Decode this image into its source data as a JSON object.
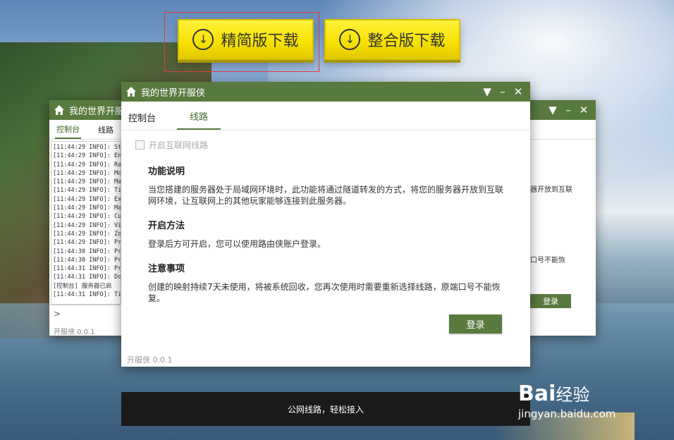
{
  "buttons": {
    "lite_label": "精简版下载",
    "full_label": "整合版下载",
    "download_icon": "↓"
  },
  "window": {
    "title": "我的世界开服侠",
    "minimize": "–",
    "menu": "▼",
    "close": "✕"
  },
  "back_window": {
    "tabs": [
      "控制台",
      "线路"
    ],
    "log": [
      "[11:44:29 INFO]: St",
      "[11:44:29 INFO]: Ent",
      "[11:44:29 INFO]: Ran",
      "[11:44:29 INFO]: Mob",
      "[11:44:29 INFO]: Max",
      "[11:44:29 INFO]: Til",
      "[11:44:29 INFO]: Exp",
      "[11:44:29 INFO]: Max",
      "[11:44:29 INFO]: Cus",
      "[11:44:29 INFO]: Vie",
      "[11:44:29 INFO]: Zom",
      "[11:44:29 INFO]: Pre",
      "[11:44:30 INFO]: Pre",
      "[11:44:30 INFO]: Pre",
      "[11:44:31 INFO]: Pre",
      "[11:44:31 INFO]: Don",
      "[控制台] 服务器已启",
      "[11:44:31 INFO]: Tim"
    ],
    "prompt": ">",
    "footer": "开服侠 0.0.1",
    "right_text_1": "器开放到互联",
    "right_text_2": "口号不能恢",
    "login_label": "登录"
  },
  "front_window": {
    "tabs": {
      "console": "控制台",
      "route": "线路"
    },
    "checkbox_label": "开启互联网线路",
    "sections": [
      {
        "heading": "功能说明",
        "text": "当您搭建的服务器处于局域网环境时，此功能将通过隧道转发的方式，将您的服务器开放到互联网环境，让互联网上的其他玩家能够连接到此服务器。"
      },
      {
        "heading": "开启方法",
        "text": "登录后方可开启，您可以使用路由侠账户登录。"
      },
      {
        "heading": "注意事项",
        "text": "创建的映射持续7天未使用，将被系统回收，您再次使用时需要重新选择线路，原端口号不能恢复。"
      }
    ],
    "login_label": "登录",
    "footer": "开服侠 0.0.1"
  },
  "banner": {
    "text": "公网线路，轻松接入"
  },
  "watermark": {
    "logo_a": "Bai",
    "logo_b": "经验",
    "url": "jingyan.baidu.com"
  }
}
